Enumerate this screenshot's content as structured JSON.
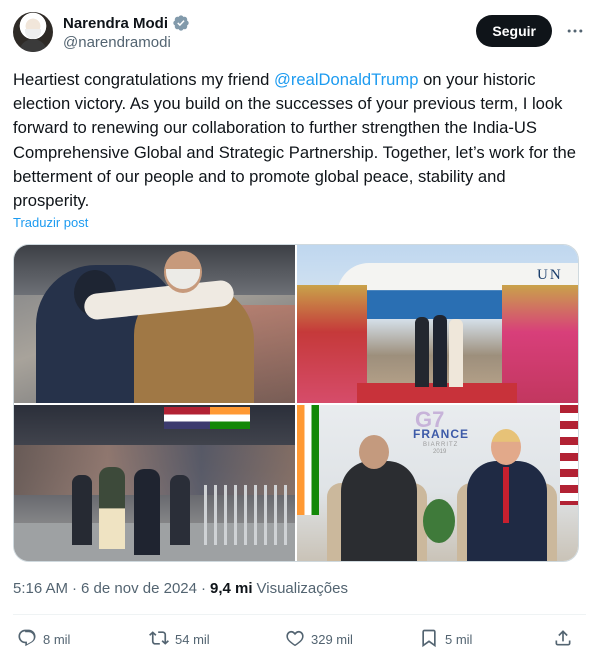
{
  "author": {
    "display_name": "Narendra Modi",
    "handle": "@narendramodi",
    "verified": true,
    "avatar_icon": "profile-photo"
  },
  "header": {
    "follow_label": "Seguir",
    "more_icon": "more-horizontal-icon"
  },
  "post": {
    "text_before": "Heartiest congratulations my friend ",
    "mention": "@realDonaldTrump",
    "text_after": " on your historic election victory. As you build on the successes of your previous term, I look forward to renewing our collaboration to further strengthen the India-US Comprehensive Global and Strategic Partnership. Together, let’s work for the betterment of our people and to promote global peace, stability and prosperity.",
    "translate_label": "Traduzir post"
  },
  "media": {
    "photos": [
      {
        "description_icon": "hug-photo"
      },
      {
        "description_icon": "airport-welcome-photo"
      },
      {
        "description_icon": "stadium-walk-photo"
      },
      {
        "description_icon": "g7-handshake-photo"
      }
    ],
    "photo_texts": {
      "airplane_text": "UN",
      "g7_logo": "G7",
      "g7_country": "FRANCE",
      "g7_city": "BIARRITZ",
      "g7_year": "2019"
    }
  },
  "meta": {
    "time": "5:16 AM",
    "separator": "·",
    "date": "6 de nov de 2024",
    "separator2": "·",
    "views_count": "9,4 mi",
    "views_label": "Visualizações"
  },
  "actions": {
    "replies": "8 mil",
    "reposts": "54 mil",
    "likes": "329 mil",
    "bookmarks": "5 mil"
  },
  "colors": {
    "accent": "#1d9bf0",
    "text_primary": "#0f1419",
    "text_secondary": "#536471",
    "follow_button_bg": "#0f1419"
  }
}
